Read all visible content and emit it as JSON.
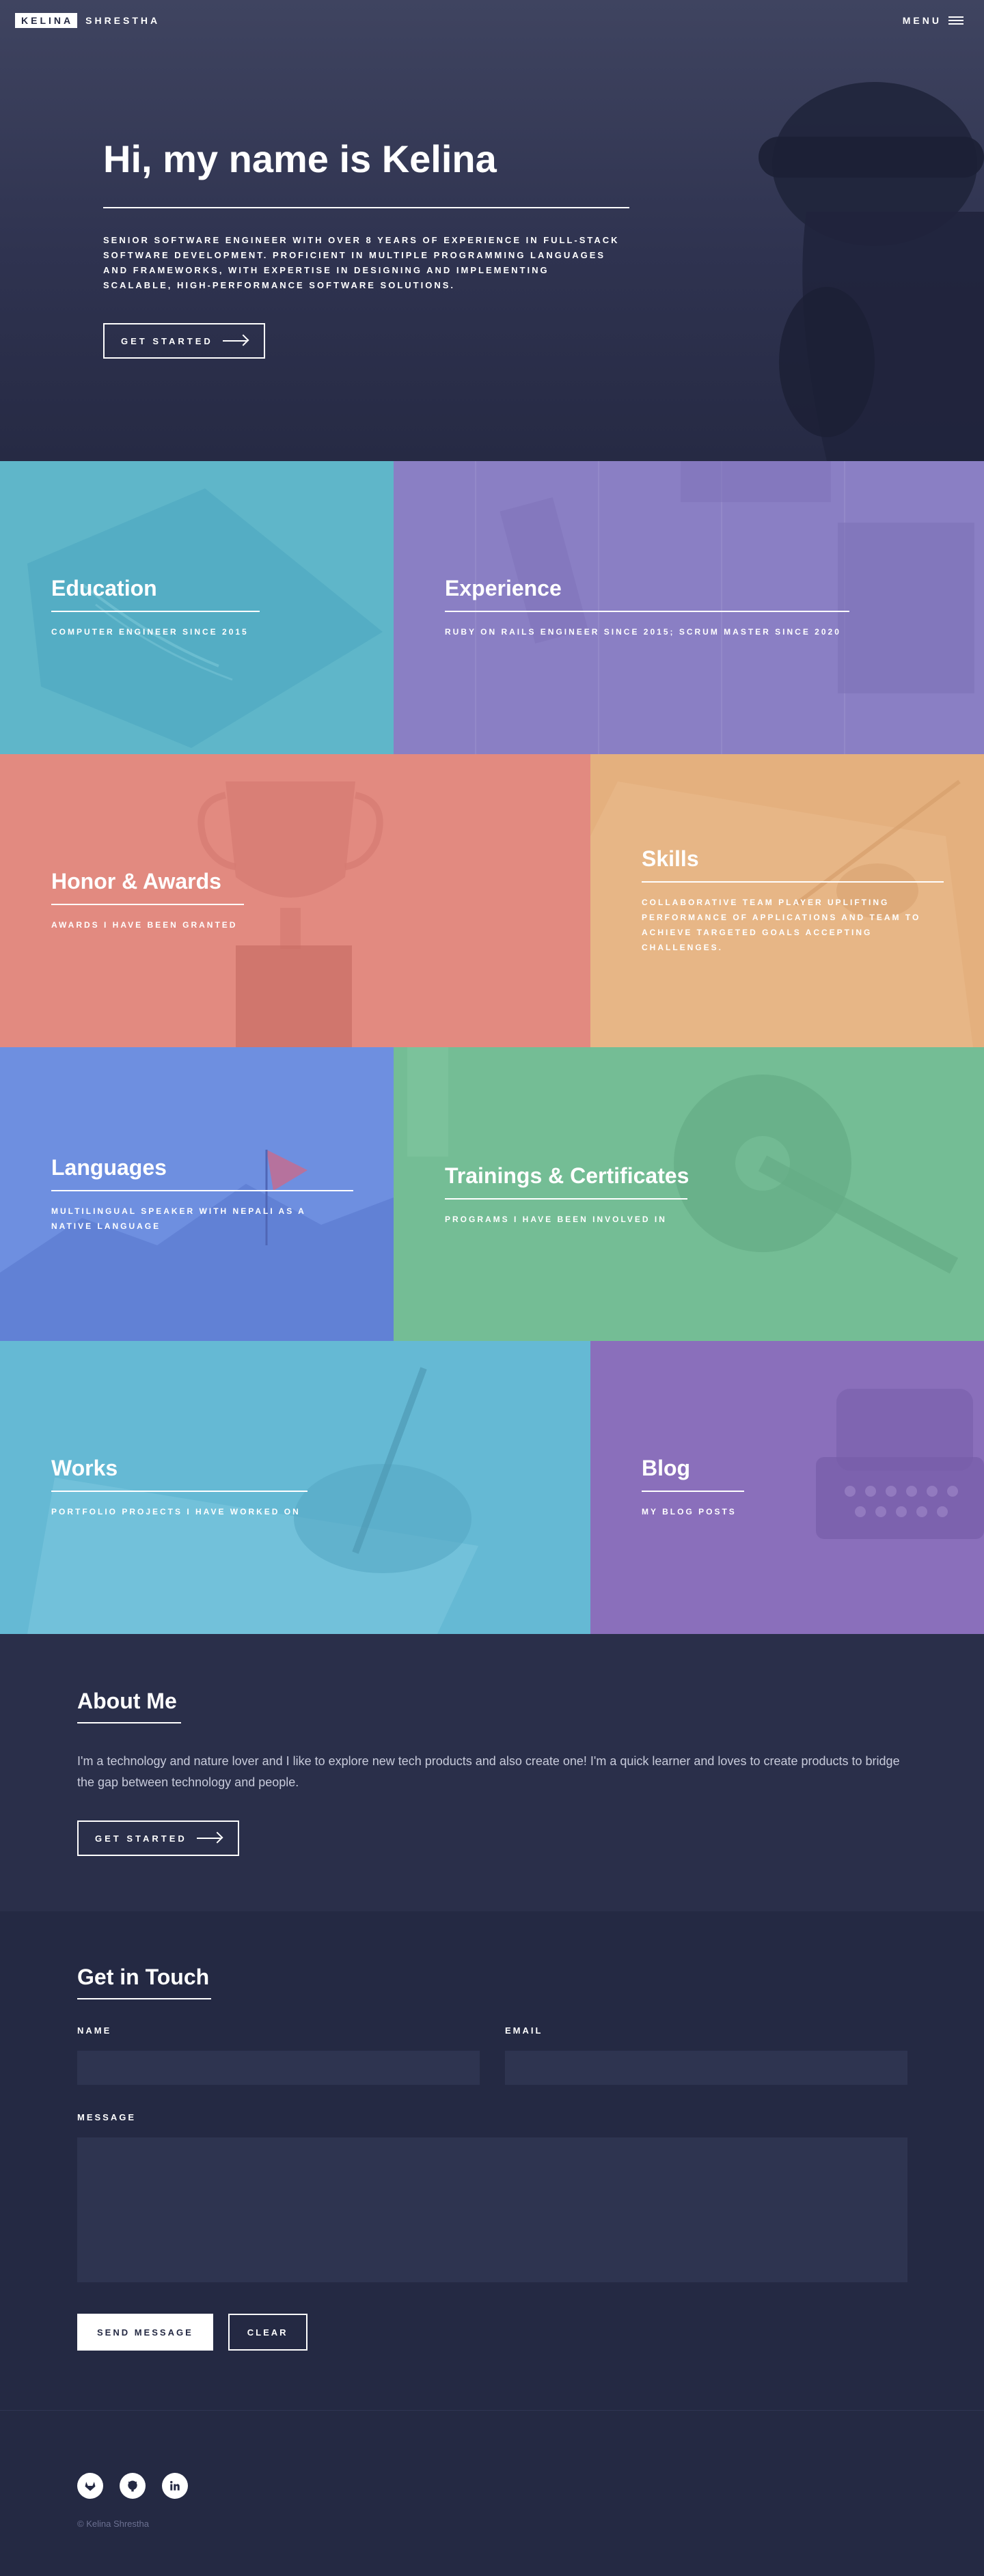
{
  "header": {
    "logo_box": "KELINA",
    "logo_rest": "SHRESTHA",
    "menu_label": "MENU"
  },
  "hero": {
    "title": "Hi, my name is Kelina",
    "description": "SENIOR SOFTWARE ENGINEER WITH OVER 8 YEARS OF EXPERIENCE IN FULL-STACK SOFTWARE DEVELOPMENT. PROFICIENT IN MULTIPLE PROGRAMMING LANGUAGES AND FRAMEWORKS, WITH EXPERTISE IN DESIGNING AND IMPLEMENTING SCALABLE, HIGH-PERFORMANCE SOFTWARE SOLUTIONS.",
    "button_label": "GET STARTED"
  },
  "tiles": {
    "education": {
      "title": "Education",
      "desc": "COMPUTER ENGINEER SINCE 2015",
      "color": "#5fb6c9"
    },
    "experience": {
      "title": "Experience",
      "desc": "RUBY ON RAILS ENGINEER SINCE 2015; SCRUM MASTER SINCE 2020",
      "color": "#8a7fc4"
    },
    "honors": {
      "title": "Honor & Awards",
      "desc": "AWARDS I HAVE BEEN GRANTED",
      "color": "#e28a80"
    },
    "skills": {
      "title": "Skills",
      "desc": "COLLABORATIVE TEAM PLAYER UPLIFTING PERFORMANCE OF APPLICATIONS AND TEAM TO ACHIEVE TARGETED GOALS ACCEPTING CHALLENGES.",
      "color": "#e4b07e"
    },
    "languages": {
      "title": "Languages",
      "desc": "MULTILINGUAL SPEAKER WITH NEPALI AS A NATIVE LANGUAGE",
      "color": "#6e8fe0"
    },
    "trainings": {
      "title": "Trainings & Certificates",
      "desc": "PROGRAMS I HAVE BEEN INVOLVED IN",
      "color": "#74bd95"
    },
    "works": {
      "title": "Works",
      "desc": "PORTFOLIO PROJECTS I HAVE WORKED ON",
      "color": "#65b9d4"
    },
    "blog": {
      "title": "Blog",
      "desc": "MY BLOG POSTS",
      "color": "#8a6fbb"
    }
  },
  "about": {
    "title": "About Me",
    "text": "I'm a technology and nature lover and I like to explore new tech products and also create one! I'm a quick learner and loves to create products to bridge the gap between technology and people.",
    "button_label": "GET STARTED"
  },
  "contact": {
    "title": "Get in Touch",
    "name_label": "NAME",
    "email_label": "EMAIL",
    "message_label": "MESSAGE",
    "name_value": "",
    "email_value": "",
    "message_value": "",
    "send_label": "SEND MESSAGE",
    "clear_label": "CLEAR"
  },
  "footer": {
    "social_icons": [
      "gitlab-icon",
      "github-icon",
      "linkedin-icon"
    ],
    "copyright": "© Kelina Shrestha"
  }
}
